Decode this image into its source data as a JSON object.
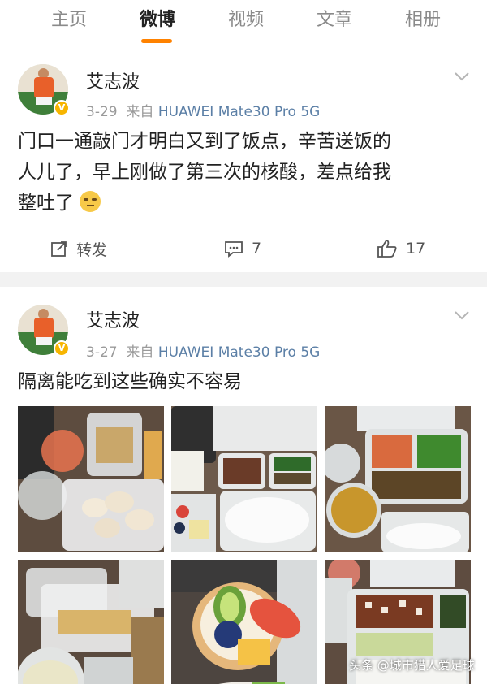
{
  "tabs": [
    {
      "label": "主页"
    },
    {
      "label": "微博"
    },
    {
      "label": "视频"
    },
    {
      "label": "文章"
    },
    {
      "label": "相册"
    }
  ],
  "active_tab": "微博",
  "accent_color": "#ff8200",
  "posts": [
    {
      "username": "艾志波",
      "date": "3-29",
      "from_label": "来自",
      "source": "HUAWEI Mate30 Pro 5G",
      "text_lines": [
        "门口一通敲门才明白又到了饭点，辛苦送饭的",
        "人儿了，早上刚做了第三次的核酸，差点给我",
        "整吐了"
      ],
      "emoji": "speechless-emoji",
      "repost_label": "转发",
      "comment_count": "7",
      "like_count": "17"
    },
    {
      "username": "艾志波",
      "date": "3-27",
      "from_label": "来自",
      "source": "HUAWEI Mate30 Pro 5G",
      "text": "隔离能吃到这些确实不容易",
      "photos": [
        "food-photo-dumplings",
        "food-photo-rice-vegetables",
        "food-photo-soup-bento",
        "food-photo-plastic-containers",
        "food-photo-fruit-tart",
        "food-photo-bento-tofu"
      ]
    }
  ],
  "watermark": "头条 @城市猎人爱足球"
}
